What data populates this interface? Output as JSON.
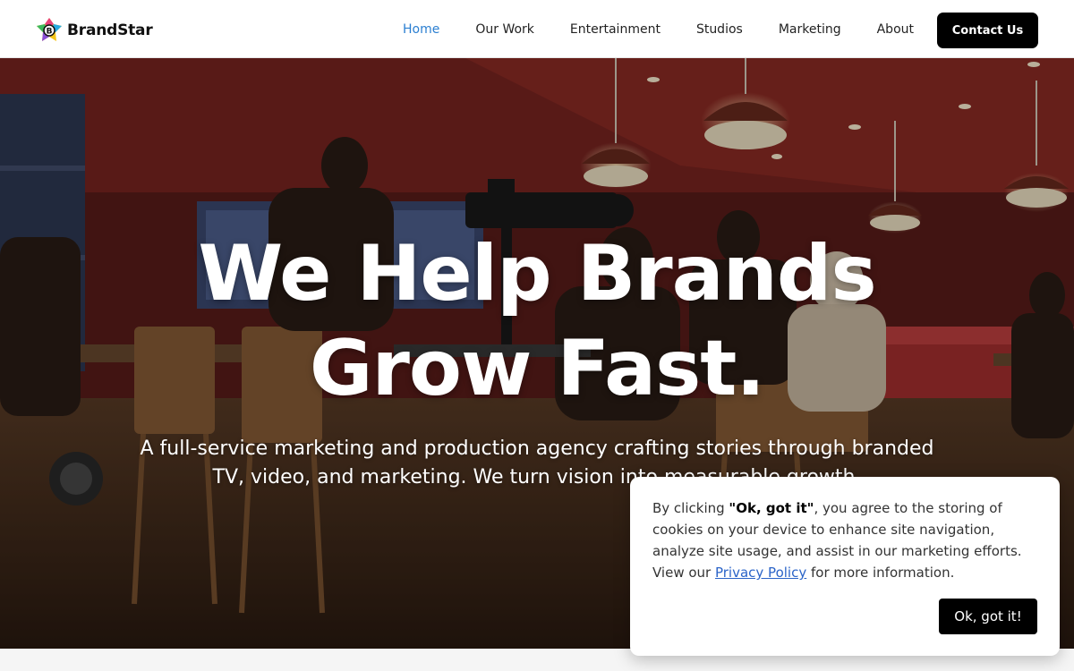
{
  "brand": {
    "name": "BrandStar",
    "logo_letter": "B"
  },
  "nav": {
    "items": [
      {
        "label": "Home",
        "active": true
      },
      {
        "label": "Our Work",
        "active": false
      },
      {
        "label": "Entertainment",
        "active": false
      },
      {
        "label": "Studios",
        "active": false
      },
      {
        "label": "Marketing",
        "active": false
      },
      {
        "label": "About",
        "active": false
      }
    ],
    "cta_label": "Contact Us"
  },
  "hero": {
    "title_line1": "We Help Brands",
    "title_line2": "Grow Fast.",
    "subtitle_line1": "A full-service marketing and production agency crafting stories through branded",
    "subtitle_line2": "TV, video, and marketing. We turn vision into measurable growth."
  },
  "cookie": {
    "text_before": "By clicking ",
    "highlight": "\"Ok, got it\"",
    "text_after": ", you agree to the storing of cookies on your device to enhance site navigation, analyze site usage, and assist in our marketing efforts. View our ",
    "link_label": "Privacy Policy",
    "text_end": " for more information.",
    "button_label": "Ok, got it!"
  },
  "colors": {
    "accent": "#2b7fd1",
    "button_bg": "#000000",
    "link": "#2b64c8",
    "logo_yellow": "#f5c518",
    "logo_pink": "#e8407a",
    "logo_blue": "#28a8e0",
    "logo_green": "#3cb85c"
  }
}
